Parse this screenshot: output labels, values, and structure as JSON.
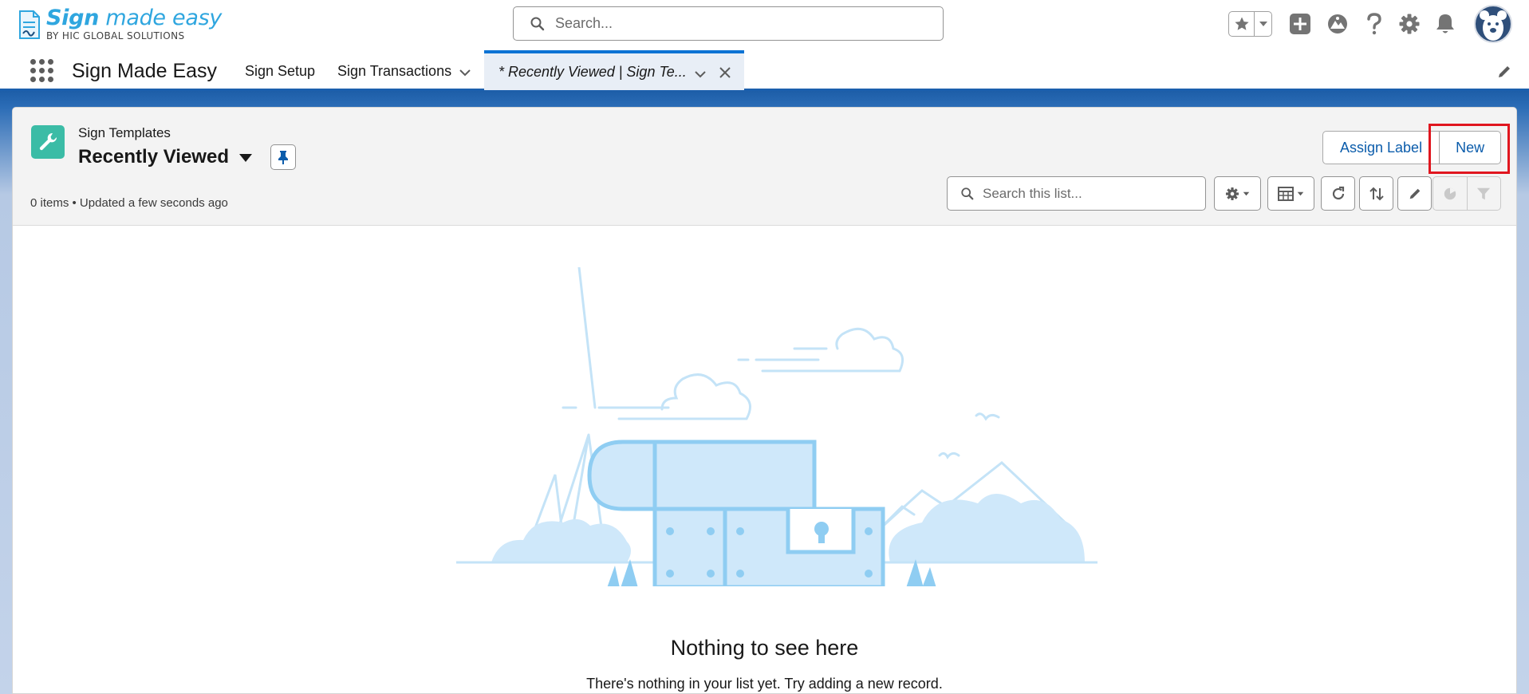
{
  "brand": {
    "logo_main_bold": "Sign",
    "logo_main_rest": " made easy",
    "logo_sub": "BY HIC GLOBAL SOLUTIONS"
  },
  "global_search": {
    "placeholder": "Search..."
  },
  "app_nav": {
    "app_name": "Sign Made Easy",
    "items": [
      {
        "label": "Sign Setup"
      },
      {
        "label": "Sign Transactions"
      }
    ],
    "active_tab": {
      "label": "* Recently Viewed | Sign Te..."
    }
  },
  "list_view": {
    "object_label": "Sign Templates",
    "title": "Recently Viewed",
    "status": "0 items • Updated a few seconds ago",
    "assign_label_button": "Assign Label",
    "new_button": "New",
    "search_placeholder": "Search this list..."
  },
  "empty_state": {
    "title": "Nothing to see here",
    "text": "There's nothing in your list yet. Try adding a new record."
  },
  "colors": {
    "brand_blue": "#1b5fad",
    "accent_link": "#0b5cab",
    "object_icon": "#3bbca6",
    "highlight_red": "#e0161f",
    "illustration_blue": "#8fcdf2"
  },
  "icons": [
    "search-icon",
    "star-icon",
    "add-icon",
    "trailhead-icon",
    "help-icon",
    "gear-icon",
    "bell-icon",
    "avatar",
    "waffle-icon",
    "chevron-down-icon",
    "close-icon",
    "pencil-icon",
    "wrench-icon",
    "pin-icon",
    "table-icon",
    "refresh-icon",
    "sort-icon",
    "chart-icon",
    "filter-icon"
  ]
}
